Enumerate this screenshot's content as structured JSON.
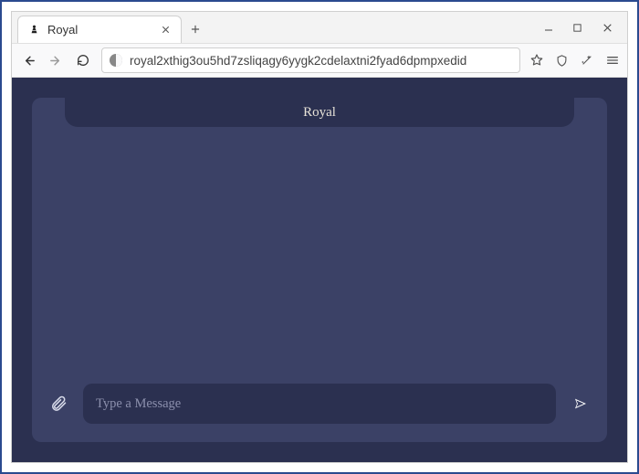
{
  "browser": {
    "tab_title": "Royal",
    "url": "royal2xthig3ou5hd7zsliqagy6yygk2cdelaxtni2fyad6dpmpxedid"
  },
  "page": {
    "header_title": "Royal",
    "compose_placeholder": "Type a Message"
  }
}
